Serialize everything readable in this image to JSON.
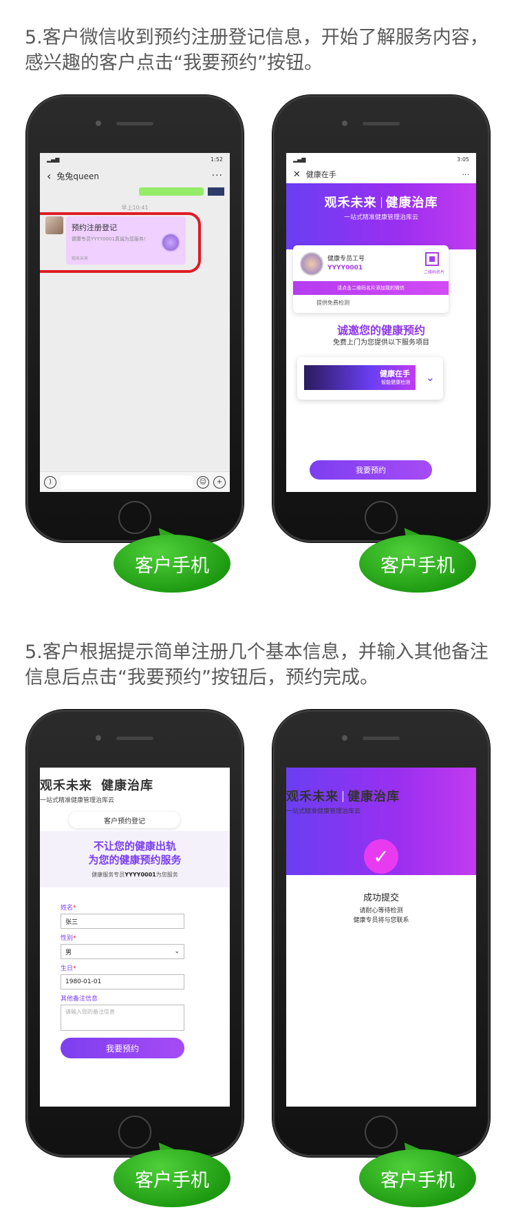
{
  "headings": {
    "step1": "5.客户微信收到预约注册登记信息，开始了解服务内容，感兴趣的客户点击“我要预约”按钮。",
    "step2": "5.客户根据提示简单注册几个基本信息，并输入其他备注信息后点击“我要预约”按钮后，预约完成。"
  },
  "bubble_label": "客户手机",
  "chat": {
    "status_time": "1:52",
    "contact": "兔兔queen",
    "timestamp": "早上10:41",
    "card_title": "预约注册登记",
    "card_desc": "健康专员YYYY0001真诚为您服务!",
    "card_source": "观禾未来"
  },
  "service": {
    "status_time": "3:05",
    "page_title": "健康在手",
    "brand_left": "观禾未来",
    "brand_right": "健康治库",
    "tagline": "一站式精准健康管理治库云",
    "specialist_label": "健康专员工号",
    "specialist_id": "YYYY0001",
    "qr_label": "二维码名片",
    "qr_hint": "请点击二维码名片添加我的微信",
    "free_check": "提供免费检测",
    "invite_title": "诚邀您的健康预约",
    "invite_sub": "免费上门为您提供以下服务项目",
    "service_name": "健康在手",
    "service_desc": "智能健康检测",
    "book_button": "我要预约"
  },
  "form": {
    "brand_left": "观禾未来",
    "brand_right": "健康治库",
    "tagline": "一站式精准健康管理治库云",
    "pill": "客户预约登记",
    "hero_line1": "不让您的健康出轨",
    "hero_line2": "为您的健康预约服务",
    "hero_line3_pre": "健康服务专员",
    "hero_line3_id": "YYYY0001",
    "hero_line3_post": "为您服务",
    "name_label": "姓名",
    "name_value": "张三",
    "gender_label": "性别",
    "gender_value": "男",
    "birth_label": "生日",
    "birth_value": "1980-01-01",
    "notes_label": "其他备注信息",
    "notes_placeholder": "请输入您的备注信息",
    "required_mark": "*",
    "submit": "我要预约"
  },
  "done": {
    "brand_left": "观禾未来",
    "brand_right": "健康治库",
    "tagline": "一站式精准健康管理治库云",
    "success": "成功提交",
    "msg1": "请耐心等待检测",
    "msg2": "健康专员将与您联系"
  },
  "colors": {
    "accent_purple": "#7b3ff0",
    "brand_magenta": "#c23bf0",
    "bubble_green": "#1f9b12",
    "highlight_red": "#e01b24"
  }
}
